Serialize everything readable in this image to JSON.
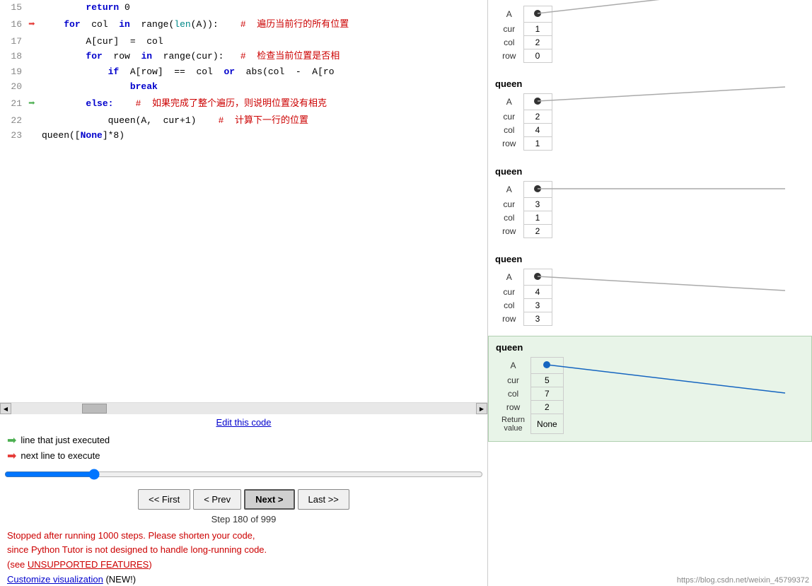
{
  "left": {
    "code_lines": [
      {
        "num": "15",
        "arrow": "",
        "code": "        return 0",
        "highlight": false
      },
      {
        "num": "16",
        "arrow": "red",
        "code": "    for  col  in  range(len(A)):    #  遍历当前行的所有位置",
        "highlight": false
      },
      {
        "num": "17",
        "arrow": "",
        "code": "        A[cur]  =  col",
        "highlight": false
      },
      {
        "num": "18",
        "arrow": "",
        "code": "        for  row  in  range(cur):   #  检查当前位置是否相",
        "highlight": false
      },
      {
        "num": "19",
        "arrow": "",
        "code": "            if  A[row]  ==  col  or  abs(col  -  A[ro",
        "highlight": false
      },
      {
        "num": "20",
        "arrow": "",
        "code": "                break",
        "highlight": false
      },
      {
        "num": "21",
        "arrow": "green",
        "code": "        else:    #  如果完成了整个遍历，则说明位置没有相克",
        "highlight": false
      },
      {
        "num": "22",
        "arrow": "",
        "code": "            queen(A,  cur+1)    #  计算下一行的位置",
        "highlight": false
      },
      {
        "num": "23",
        "arrow": "",
        "code": "queen([None]*8)",
        "highlight": false
      }
    ],
    "edit_link_text": "Edit this code",
    "legend_executed": "line that just executed",
    "legend_next": "next line to execute",
    "nav": {
      "first_label": "<< First",
      "prev_label": "< Prev",
      "next_label": "Next >",
      "last_label": "Last >>"
    },
    "step_text": "Step 180 of 999",
    "error_line1": "Stopped after running 1000 steps. Please shorten your code,",
    "error_line2": "since Python Tutor is not designed to handle long-running code.",
    "error_line3_prefix": "(see ",
    "error_link_text": "UNSUPPORTED FEATURES",
    "error_line3_suffix": ")",
    "customize_label": "Customize visualization",
    "customize_new": " (NEW!)"
  },
  "right": {
    "frames": [
      {
        "id": "frame1",
        "title": "",
        "active": false,
        "vars": [
          {
            "label": "cur",
            "value": "1"
          },
          {
            "label": "col",
            "value": "2"
          },
          {
            "label": "row",
            "value": "0"
          }
        ],
        "has_A": true,
        "A_dot": true
      },
      {
        "id": "frame2",
        "title": "queen",
        "active": false,
        "vars": [
          {
            "label": "cur",
            "value": "2"
          },
          {
            "label": "col",
            "value": "4"
          },
          {
            "label": "row",
            "value": "1"
          }
        ],
        "has_A": true,
        "A_dot": true
      },
      {
        "id": "frame3",
        "title": "queen",
        "active": false,
        "vars": [
          {
            "label": "cur",
            "value": "3"
          },
          {
            "label": "col",
            "value": "1"
          },
          {
            "label": "row",
            "value": "2"
          }
        ],
        "has_A": true,
        "A_dot": true
      },
      {
        "id": "frame4",
        "title": "queen",
        "active": false,
        "vars": [
          {
            "label": "cur",
            "value": "4"
          },
          {
            "label": "col",
            "value": "3"
          },
          {
            "label": "row",
            "value": "3"
          }
        ],
        "has_A": true,
        "A_dot": true
      },
      {
        "id": "frame5",
        "title": "queen",
        "active": true,
        "vars": [
          {
            "label": "cur",
            "value": "5"
          },
          {
            "label": "col",
            "value": "7"
          },
          {
            "label": "row",
            "value": "2"
          }
        ],
        "has_A": true,
        "A_dot": true,
        "return_value": "None"
      }
    ],
    "watermark": "https://blog.csdn.net/weixin_45799372"
  }
}
